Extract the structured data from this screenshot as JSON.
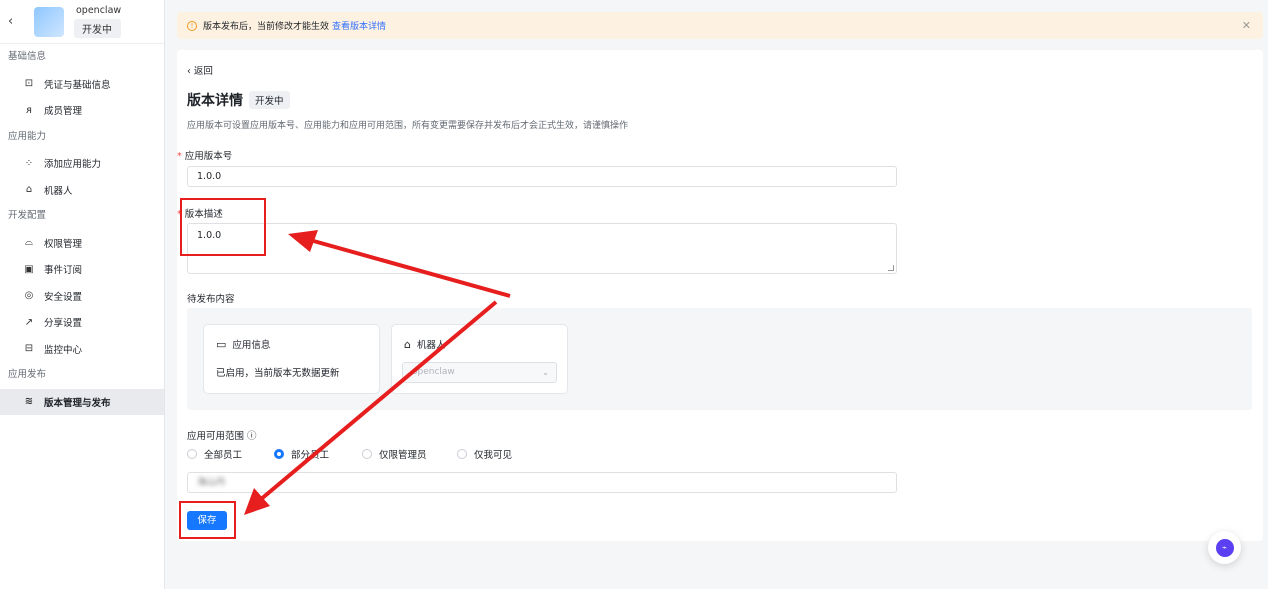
{
  "sidebar": {
    "app_name": "openclaw",
    "app_status": "开发中",
    "groups": [
      {
        "title": "基础信息",
        "items": [
          {
            "label": "凭证与基础信息",
            "icon": "credential-icon"
          },
          {
            "label": "成员管理",
            "icon": "member-icon"
          }
        ]
      },
      {
        "title": "应用能力",
        "items": [
          {
            "label": "添加应用能力",
            "icon": "add-ability-icon"
          },
          {
            "label": "机器人",
            "icon": "robot-icon"
          }
        ]
      },
      {
        "title": "开发配置",
        "items": [
          {
            "label": "权限管理",
            "icon": "lock-icon"
          },
          {
            "label": "事件订阅",
            "icon": "event-icon"
          },
          {
            "label": "安全设置",
            "icon": "shield-icon"
          },
          {
            "label": "分享设置",
            "icon": "share-icon"
          },
          {
            "label": "监控中心",
            "icon": "monitor-icon"
          }
        ]
      },
      {
        "title": "应用发布",
        "items": [
          {
            "label": "版本管理与发布",
            "icon": "layers-icon",
            "active": true
          }
        ]
      }
    ]
  },
  "notice": {
    "text": "版本发布后，当前修改才能生效",
    "link": "查看版本详情"
  },
  "main": {
    "back": "返回",
    "title": "版本详情",
    "status": "开发中",
    "description": "应用版本可设置应用版本号、应用能力和应用可用范围，所有变更需要保存并发布后才会正式生效，请谨慎操作",
    "version_label": "应用版本号",
    "version_value": "1.0.0",
    "desc_label": "版本描述",
    "desc_value": "1.0.0",
    "pending_label": "待发布内容",
    "app_info_title": "应用信息",
    "app_info_text": "已启用，当前版本无数据更新",
    "robot_title": "机器人",
    "robot_select": "openclaw",
    "scope_label": "应用可用范围",
    "scope_options": [
      "全部员工",
      "部分员工",
      "仅限管理员",
      "仅我可见"
    ],
    "scope_selected": 1,
    "scope_value": "海山丹",
    "save": "保存"
  },
  "colors": {
    "primary": "#1677ff",
    "annotation": "#e61e1e",
    "notice_bg": "#fdf2e1",
    "warning": "#f59a23"
  }
}
